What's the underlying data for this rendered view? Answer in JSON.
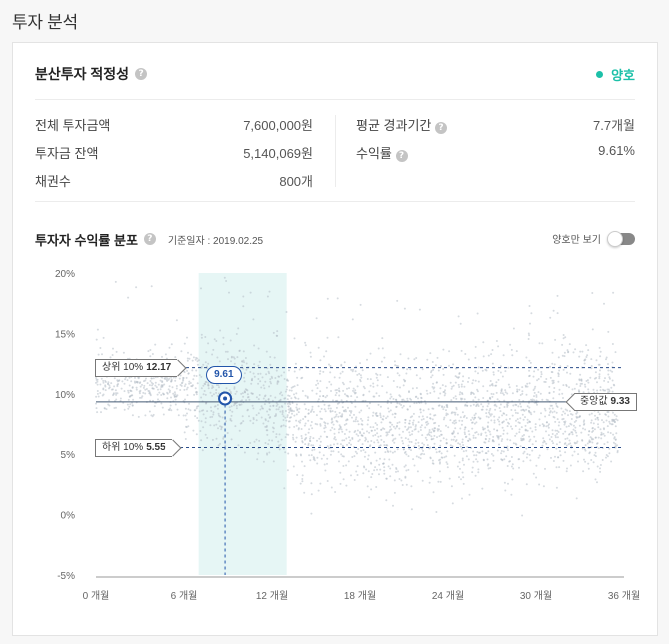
{
  "page": {
    "title": "투자 분석"
  },
  "adequacy": {
    "title": "분산투자 적정성",
    "help_icon": "question-icon",
    "status_label": "양호",
    "status_color": "#1cc0a8"
  },
  "stats": {
    "left": [
      {
        "label": "전체 투자금액",
        "value": "7,600,000원"
      },
      {
        "label": "투자금 잔액",
        "value": "5,140,069원"
      },
      {
        "label": "채권수",
        "value": "800개"
      }
    ],
    "right": [
      {
        "label": "평균 경과기간",
        "value": "7.7개월"
      },
      {
        "label": "수익률",
        "value": "9.61%"
      }
    ]
  },
  "distribution": {
    "title": "투자자 수익률 분포",
    "base_date": "기준일자 : 2019.02.25",
    "toggle_label": "양호만 보기",
    "toggle_on": false
  },
  "chart_data": {
    "type": "scatter",
    "x_unit": "개월",
    "x_ticks": [
      "0 개월",
      "6 개월",
      "12 개월",
      "18 개월",
      "24 개월",
      "30 개월",
      "36 개월"
    ],
    "y_ticks": [
      "20%",
      "15%",
      "10%",
      "5%",
      "0%",
      "-5%"
    ],
    "xlim": [
      0,
      36
    ],
    "ylim": [
      -5,
      20
    ],
    "highlight_band": [
      7,
      13
    ],
    "highlight_color": "#e6f6f5",
    "point_color": "#b4bec6",
    "upper_10": {
      "label": "상위 10%",
      "value": "12.17",
      "y": 12.17
    },
    "lower_10": {
      "label": "하위 10%",
      "value": "5.55",
      "y": 5.55
    },
    "median": {
      "label": "중앙값",
      "value": "9.33",
      "y": 9.33
    },
    "mine": {
      "label": "9.61",
      "x": 8.8,
      "y": 9.61,
      "color": "#2255aa"
    }
  }
}
